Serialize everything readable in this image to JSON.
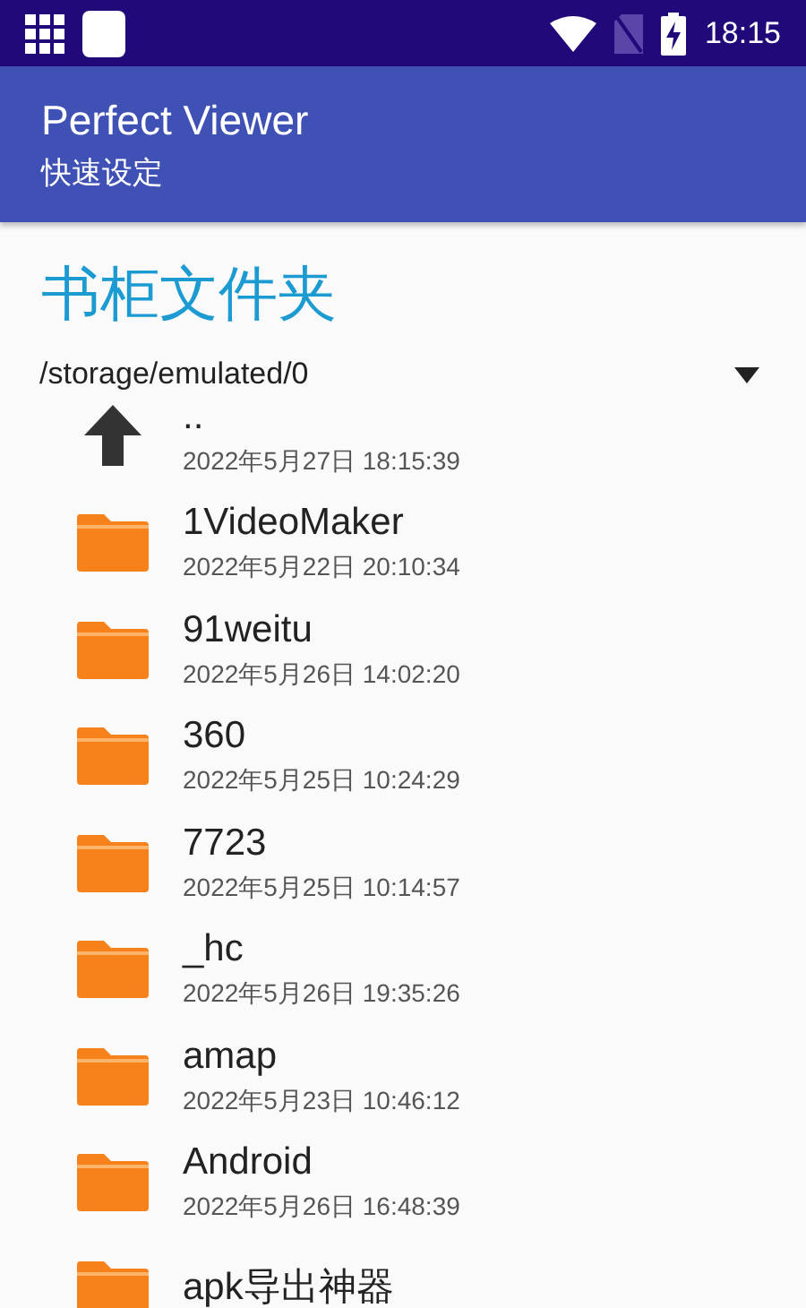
{
  "status_bar": {
    "time": "18:15"
  },
  "app_bar": {
    "title": "Perfect Viewer",
    "subtitle": "快速设定"
  },
  "heading": "书柜文件夹",
  "path": {
    "value": "/storage/emulated/0"
  },
  "entries": [
    {
      "kind": "up",
      "name": "..",
      "date": "2022年5月27日 18:15:39"
    },
    {
      "kind": "folder",
      "name": "1VideoMaker",
      "date": "2022年5月22日 20:10:34"
    },
    {
      "kind": "folder",
      "name": "91weitu",
      "date": "2022年5月26日 14:02:20"
    },
    {
      "kind": "folder",
      "name": "360",
      "date": "2022年5月25日 10:24:29"
    },
    {
      "kind": "folder",
      "name": "7723",
      "date": "2022年5月25日 10:14:57"
    },
    {
      "kind": "folder",
      "name": "_hc",
      "date": "2022年5月26日 19:35:26"
    },
    {
      "kind": "folder",
      "name": "amap",
      "date": "2022年5月23日 10:46:12"
    },
    {
      "kind": "folder",
      "name": "Android",
      "date": "2022年5月26日 16:48:39"
    },
    {
      "kind": "folder",
      "name": "apk导出神器"
    }
  ]
}
